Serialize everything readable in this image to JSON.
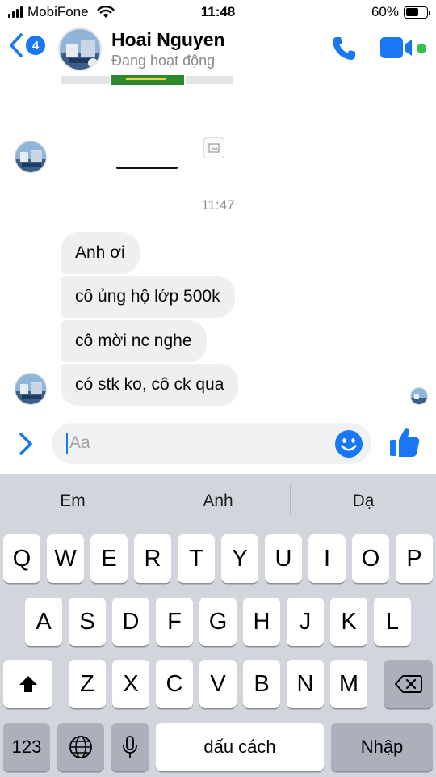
{
  "status_bar": {
    "carrier": "MobiFone",
    "time": "11:48",
    "battery_percent": "60%",
    "battery_level": 0.6,
    "icons": [
      "signal-icon",
      "wifi-icon",
      "battery-icon"
    ]
  },
  "header": {
    "back_badge": "4",
    "contact_name": "Hoai Nguyen",
    "status": "Đang hoạt động",
    "icons": [
      "back-chevron-icon",
      "phone-icon",
      "video-camera-icon"
    ],
    "accent_color": "#1877f2",
    "online_color": "#31c24a"
  },
  "chat": {
    "timestamp": "11:47",
    "messages": [
      "Anh ơi",
      "cô ủng hộ lớp 500k",
      "cô mời nc nghe",
      "có stk ko, cô ck qua"
    ],
    "bubble_color": "#eeeff1"
  },
  "composer": {
    "placeholder": "Aa",
    "icons": [
      "chevron-right-icon",
      "emoji-icon",
      "thumbs-up-icon"
    ]
  },
  "keyboard": {
    "predictions": [
      "Em",
      "Anh",
      "Dạ"
    ],
    "row1": [
      "Q",
      "W",
      "E",
      "R",
      "T",
      "Y",
      "U",
      "I",
      "O",
      "P"
    ],
    "row2": [
      "A",
      "S",
      "D",
      "F",
      "G",
      "H",
      "J",
      "K",
      "L"
    ],
    "row3": [
      "Z",
      "X",
      "C",
      "V",
      "B",
      "N",
      "M"
    ],
    "numbers_key": "123",
    "space_key": "dấu cách",
    "return_key": "Nhập",
    "icons": [
      "shift-icon",
      "backspace-icon",
      "globe-icon",
      "microphone-icon"
    ]
  }
}
